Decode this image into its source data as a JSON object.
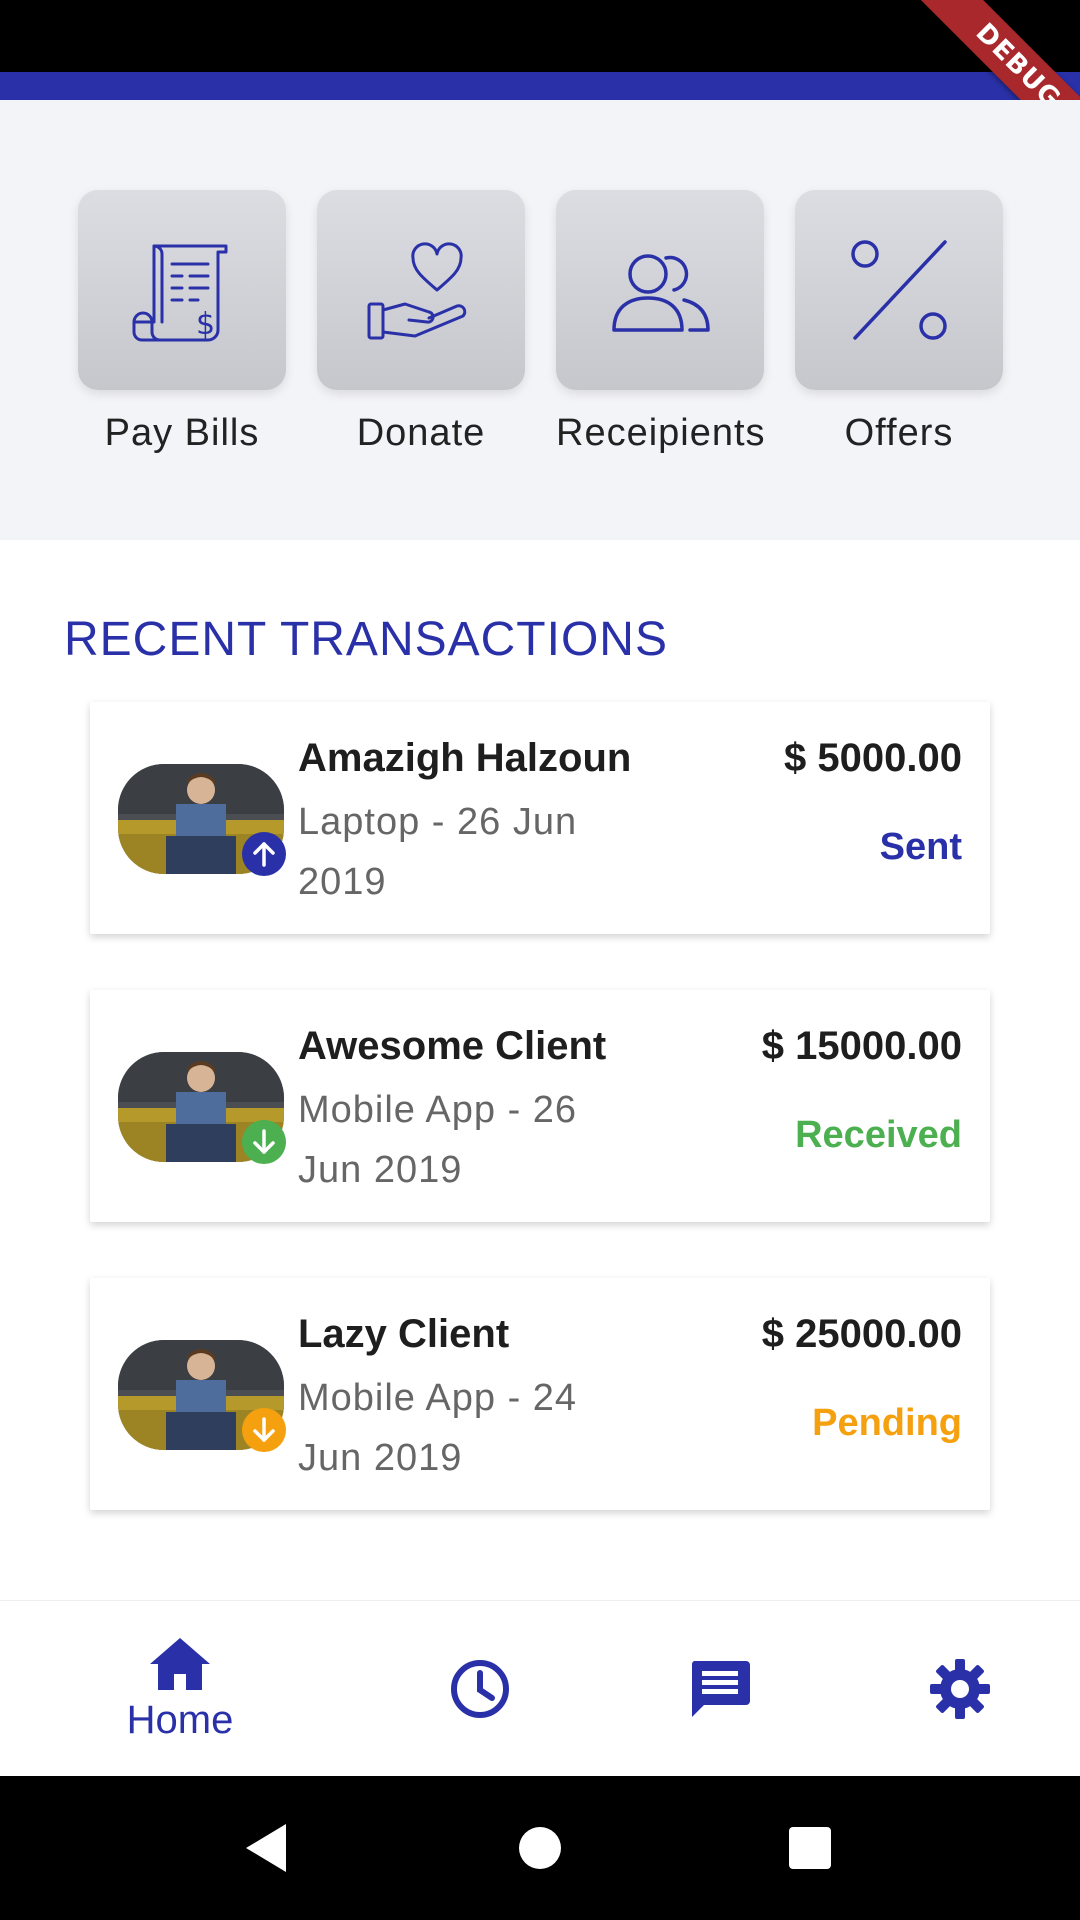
{
  "debug_banner": "DEBUG",
  "quick_actions": [
    {
      "label": "Pay Bills",
      "icon": "receipt-bill-icon"
    },
    {
      "label": "Donate",
      "icon": "heart-hand-icon"
    },
    {
      "label": "Receipients",
      "icon": "users-icon"
    },
    {
      "label": "Offers",
      "icon": "percent-icon"
    }
  ],
  "recent_transactions": {
    "title": "RECENT TRANSACTIONS",
    "items": [
      {
        "name": "Amazigh Halzoun",
        "description": "Laptop - 26 Jun 2019",
        "amount": "$ 5000.00",
        "status": "Sent",
        "status_color": "#2a31a8",
        "badge": "arrow-up-icon",
        "badge_color": "#2a31a8"
      },
      {
        "name": "Awesome Client",
        "description": "Mobile App - 26 Jun 2019",
        "amount": "$ 15000.00",
        "status": "Received",
        "status_color": "#4caf50",
        "badge": "arrow-down-icon",
        "badge_color": "#4caf50"
      },
      {
        "name": "Lazy Client",
        "description": "Mobile App - 24 Jun 2019",
        "amount": "$ 25000.00",
        "status": "Pending",
        "status_color": "#f5a00f",
        "badge": "arrow-down-icon",
        "badge_color": "#f5a00f"
      }
    ]
  },
  "bottom_nav": {
    "items": [
      {
        "label": "Home",
        "icon": "home-icon",
        "active": true
      },
      {
        "label": "",
        "icon": "clock-icon",
        "active": false
      },
      {
        "label": "",
        "icon": "message-icon",
        "active": false
      },
      {
        "label": "",
        "icon": "gear-icon",
        "active": false
      }
    ]
  },
  "colors": {
    "primary": "#2a31a8",
    "received": "#4caf50",
    "pending": "#f5a00f"
  }
}
